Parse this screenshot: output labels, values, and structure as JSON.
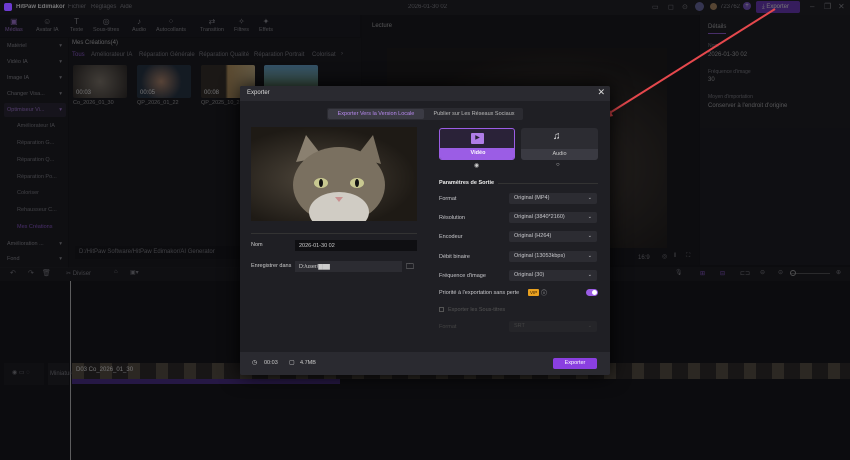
{
  "app": {
    "name": "HitPaw Edimakor",
    "menu": [
      "Fichier",
      "Réglages",
      "Aide"
    ],
    "project_title": "2026-01-30 02",
    "credits": "723762",
    "export_label": "Exporter"
  },
  "toolbar": [
    {
      "label": "Médias",
      "icon": "media-icon"
    },
    {
      "label": "Avatar IA",
      "icon": "avatar-icon"
    },
    {
      "label": "Texte",
      "icon": "text-icon"
    },
    {
      "label": "Sous-titres",
      "icon": "subtitles-icon"
    },
    {
      "label": "Audio",
      "icon": "music-icon"
    },
    {
      "label": "Autocollants",
      "icon": "sticker-icon"
    },
    {
      "label": "Transition",
      "icon": "transition-icon"
    },
    {
      "label": "Filtres",
      "icon": "filter-icon"
    },
    {
      "label": "Effets",
      "icon": "effects-icon"
    }
  ],
  "sidebar": {
    "items": [
      "Matériel",
      "Vidéo IA",
      "Image IA",
      "Changer Visa...",
      "Optimiseur Vi..."
    ],
    "subitems": [
      "Améliorateur IA",
      "Réparation G...",
      "Réparation Q...",
      "Réparation Po...",
      "Coloriser",
      "Rehausseur C...",
      "Mes Créations"
    ],
    "bottom": [
      "Amélioration ...",
      "Fond"
    ]
  },
  "media": {
    "title": "Mes Créations(4)",
    "tabs": [
      "Tous",
      "Améliorateur IA",
      "Réparation Générale",
      "Réparation Qualité",
      "Réparation Portrait",
      "Colorisat"
    ],
    "items": [
      {
        "name": "Co_2026_01_30",
        "duration": "00:03"
      },
      {
        "name": "QP_2026_01_22",
        "duration": "00:05"
      },
      {
        "name": "QP_2025_10_21",
        "duration": "00:08"
      },
      {
        "name": "",
        "duration": ""
      }
    ],
    "path": "D:/HitPaw Software/HitPaw Edimakor/AI Generator"
  },
  "preview": {
    "title": "Lecture",
    "ratio": "16:9"
  },
  "details": {
    "tab": "Détails",
    "fields": [
      {
        "label": "Nom",
        "value": "2026-01-30 02"
      },
      {
        "label": "Fréquence d'image",
        "value": "30"
      },
      {
        "label": "Moyen d'importation",
        "value": "Conserver à l'endroit d'origine"
      }
    ]
  },
  "timeline": {
    "split_label": "Diviser",
    "clip_label": "D03 Co_2026_01_30",
    "track_label": "Miniature"
  },
  "dialog": {
    "title": "Exporter",
    "tabs": [
      "Exporter Vers la Version Locale",
      "Publier sur Les Réseaux Sociaux"
    ],
    "active_tab": 0,
    "types": [
      {
        "label": "Vidéo",
        "selected": true
      },
      {
        "label": "Audio",
        "selected": false
      }
    ],
    "params_title": "Paramètres de Sortie",
    "params": [
      {
        "label": "Format",
        "value": "Original (MP4)"
      },
      {
        "label": "Résolution",
        "value": "Original (3840*2160)"
      },
      {
        "label": "Encodeur",
        "value": "Original (H264)"
      },
      {
        "label": "Débit binaire",
        "value": "Original (13053kbps)"
      },
      {
        "label": "Fréquence d'image",
        "value": "Original (30)"
      }
    ],
    "lossless_label": "Priorité à l'exportation sans perte",
    "vip": "VIP",
    "lossless_on": true,
    "subtitles_label": "Exporter les Sous-titres",
    "subtitles_format_label": "Format",
    "subtitles_format": "SRT",
    "name_label": "Nom",
    "name_value": "2026-01-30 02",
    "save_label": "Enregistrer dans",
    "save_value": "D:/user/███",
    "duration": "00:03",
    "size": "4.7MB",
    "export_button": "Exporter"
  },
  "colors": {
    "accent": "#9b5de5",
    "annotation": "#e5484d"
  }
}
